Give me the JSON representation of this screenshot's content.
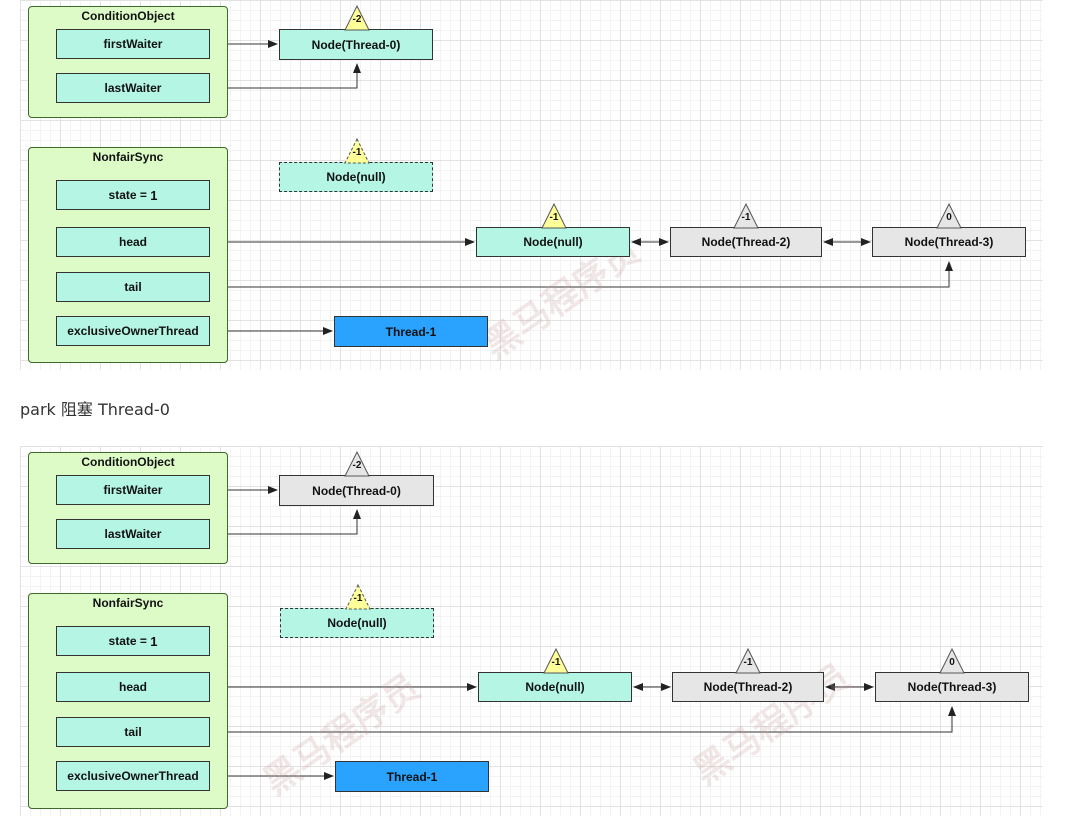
{
  "caption": "park 阻塞 Thread-0",
  "diagrams": [
    {
      "condition_object": {
        "title": "ConditionObject",
        "first_waiter": "firstWaiter",
        "last_waiter": "lastWaiter"
      },
      "waiter_node": {
        "label": "Node(Thread-0)",
        "badge": "-2",
        "badge_color": "#ffff99",
        "fill": "#b4f5e4"
      },
      "nonfair_sync": {
        "title": "NonfairSync",
        "state_label": "state = ",
        "state_value": "1",
        "head": "head",
        "tail": "tail",
        "owner": "exclusiveOwnerThread"
      },
      "detached_node": {
        "label": "Node(null)",
        "badge": "-1"
      },
      "queue": [
        {
          "label": "Node(null)",
          "badge": "-1",
          "badge_color": "#ffff99"
        },
        {
          "label": "Node(Thread-2)",
          "badge": "-1",
          "badge_color": "#e6e6e6"
        },
        {
          "label": "Node(Thread-3)",
          "badge": "0",
          "badge_color": "#e6e6e6"
        }
      ],
      "owner_thread": "Thread-1"
    },
    {
      "condition_object": {
        "title": "ConditionObject",
        "first_waiter": "firstWaiter",
        "last_waiter": "lastWaiter"
      },
      "waiter_node": {
        "label": "Node(Thread-0)",
        "badge": "-2",
        "badge_color": "#e6e6e6",
        "fill": "#e6e6e6"
      },
      "nonfair_sync": {
        "title": "NonfairSync",
        "state_label": "state = ",
        "state_value": "1",
        "head": "head",
        "tail": "tail",
        "owner": "exclusiveOwnerThread"
      },
      "detached_node": {
        "label": "Node(null)",
        "badge": "-1"
      },
      "queue": [
        {
          "label": "Node(null)",
          "badge": "-1",
          "badge_color": "#ffff99"
        },
        {
          "label": "Node(Thread-2)",
          "badge": "-1",
          "badge_color": "#e6e6e6"
        },
        {
          "label": "Node(Thread-3)",
          "badge": "0",
          "badge_color": "#e6e6e6"
        }
      ],
      "owner_thread": "Thread-1"
    }
  ],
  "colors": {
    "group_fill": "#ddfbc7",
    "field_fill": "#b4f5e4",
    "node_gray": "#e6e6e6",
    "thread_blue": "#29a3ff",
    "badge_yellow": "#ffff99"
  }
}
